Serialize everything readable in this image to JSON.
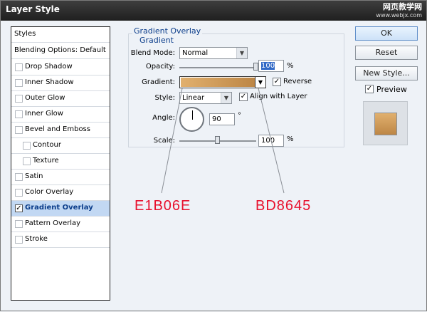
{
  "window": {
    "title": "Layer Style",
    "watermark_title": "网页教学网",
    "watermark_url": "www.webjx.com"
  },
  "styles_list": {
    "items": [
      {
        "label": "Styles",
        "checkbox": false,
        "checked": false
      },
      {
        "label": "Blending Options: Default",
        "checkbox": false,
        "checked": false
      },
      {
        "label": "Drop Shadow",
        "checkbox": true,
        "checked": false
      },
      {
        "label": "Inner Shadow",
        "checkbox": true,
        "checked": false
      },
      {
        "label": "Outer Glow",
        "checkbox": true,
        "checked": false
      },
      {
        "label": "Inner Glow",
        "checkbox": true,
        "checked": false
      },
      {
        "label": "Bevel and Emboss",
        "checkbox": true,
        "checked": false
      },
      {
        "label": "Contour",
        "checkbox": true,
        "checked": false,
        "sub": true
      },
      {
        "label": "Texture",
        "checkbox": true,
        "checked": false,
        "sub": true
      },
      {
        "label": "Satin",
        "checkbox": true,
        "checked": false
      },
      {
        "label": "Color Overlay",
        "checkbox": true,
        "checked": false
      },
      {
        "label": "Gradient Overlay",
        "checkbox": true,
        "checked": true,
        "selected": true
      },
      {
        "label": "Pattern Overlay",
        "checkbox": true,
        "checked": false
      },
      {
        "label": "Stroke",
        "checkbox": true,
        "checked": false
      }
    ]
  },
  "gradient_overlay": {
    "group_title": "Gradient Overlay",
    "sub_title": "Gradient",
    "blend_mode_label": "Blend Mode:",
    "blend_mode_value": "Normal",
    "opacity_label": "Opacity:",
    "opacity_value": "100",
    "opacity_unit": "%",
    "opacity_fraction": 1.0,
    "gradient_label": "Gradient:",
    "gradient_colors": [
      "#E1B06E",
      "#BD8645"
    ],
    "reverse_label": "Reverse",
    "reverse_checked": true,
    "style_label": "Style:",
    "style_value": "Linear",
    "align_label": "Align with Layer",
    "align_checked": true,
    "angle_label": "Angle:",
    "angle_value": "90",
    "angle_unit": "°",
    "scale_label": "Scale:",
    "scale_value": "100",
    "scale_unit": "%",
    "scale_fraction": 0.5
  },
  "annotations": {
    "left_color": "E1B06E",
    "right_color": "BD8645",
    "color": "#e8112d"
  },
  "buttons": {
    "ok": "OK",
    "reset": "Reset",
    "new_style": "New Style..."
  },
  "preview": {
    "label": "Preview",
    "checked": true
  }
}
